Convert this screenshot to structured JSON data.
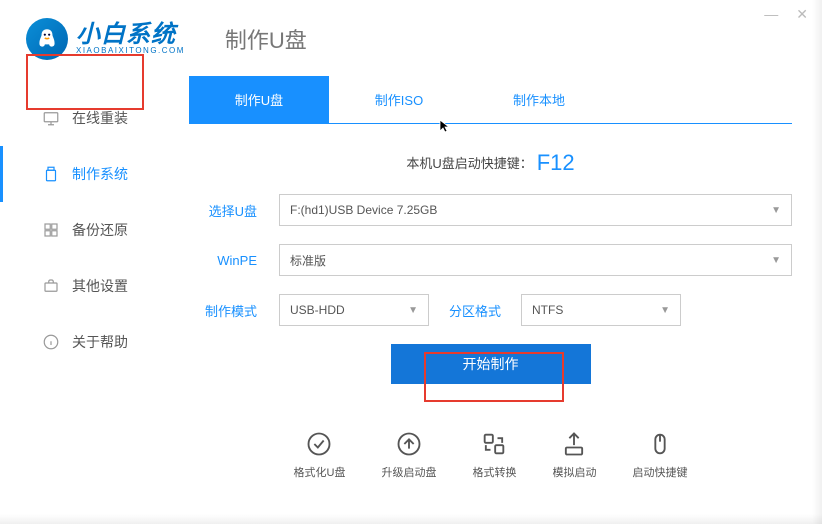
{
  "window": {
    "min": "—",
    "close": "✕"
  },
  "brand": {
    "name": "小白系统",
    "sub": "XIAOBAIXITONG.COM"
  },
  "page_title": "制作U盘",
  "sidebar": {
    "items": [
      {
        "label": "在线重装"
      },
      {
        "label": "制作系统"
      },
      {
        "label": "备份还原"
      },
      {
        "label": "其他设置"
      },
      {
        "label": "关于帮助"
      }
    ]
  },
  "tabs": [
    {
      "label": "制作U盘"
    },
    {
      "label": "制作ISO"
    },
    {
      "label": "制作本地"
    }
  ],
  "boot_hint": {
    "text": "本机U盘启动快捷键：",
    "key": "F12"
  },
  "form": {
    "select_usb_label": "选择U盘",
    "select_usb_value": "F:(hd1)USB Device 7.25GB",
    "winpe_label": "WinPE",
    "winpe_value": "标准版",
    "mode_label": "制作模式",
    "mode_value": "USB-HDD",
    "partition_label": "分区格式",
    "partition_value": "NTFS"
  },
  "primary_button": "开始制作",
  "bottom": [
    {
      "label": "格式化U盘"
    },
    {
      "label": "升级启动盘"
    },
    {
      "label": "格式转换"
    },
    {
      "label": "模拟启动"
    },
    {
      "label": "启动快捷键"
    }
  ]
}
